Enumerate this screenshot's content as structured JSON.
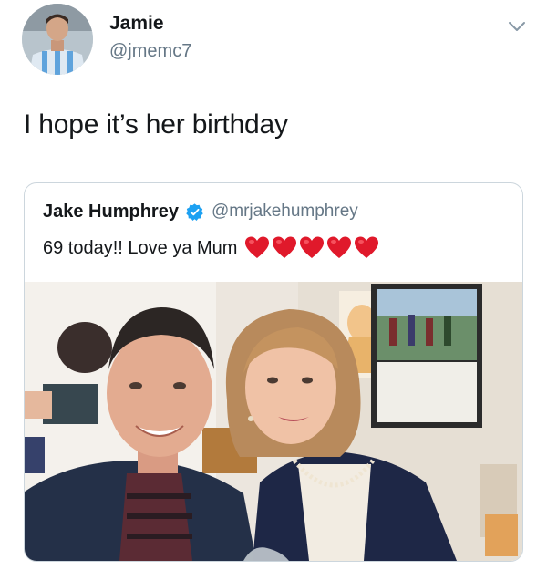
{
  "tweet": {
    "author": {
      "display_name": "Jamie",
      "handle": "@jmemc7",
      "avatar_icon": "profile-photo"
    },
    "text": "I hope it’s her birthday",
    "menu_icon": "chevron-down-icon",
    "quoted": {
      "display_name": "Jake Humphrey",
      "verified": true,
      "verified_icon": "verified-badge-icon",
      "handle": "@mrjakehumphrey",
      "text": "69 today!! Love ya Mum",
      "emoji": [
        "heart",
        "heart",
        "heart",
        "heart",
        "heart"
      ],
      "photo": "selfie-photo"
    }
  },
  "colors": {
    "text_primary": "#14171a",
    "text_secondary": "#657786",
    "border": "#ccd6dd",
    "verified_blue": "#1da1f2",
    "heart_red": "#e0192b"
  }
}
